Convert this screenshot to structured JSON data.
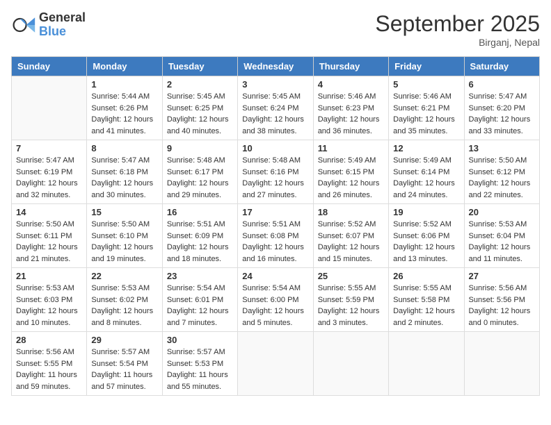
{
  "header": {
    "logo_general": "General",
    "logo_blue": "Blue",
    "month": "September 2025",
    "location": "Birganj, Nepal"
  },
  "days_of_week": [
    "Sunday",
    "Monday",
    "Tuesday",
    "Wednesday",
    "Thursday",
    "Friday",
    "Saturday"
  ],
  "weeks": [
    [
      {
        "day": "",
        "info": ""
      },
      {
        "day": "1",
        "info": "Sunrise: 5:44 AM\nSunset: 6:26 PM\nDaylight: 12 hours\nand 41 minutes."
      },
      {
        "day": "2",
        "info": "Sunrise: 5:45 AM\nSunset: 6:25 PM\nDaylight: 12 hours\nand 40 minutes."
      },
      {
        "day": "3",
        "info": "Sunrise: 5:45 AM\nSunset: 6:24 PM\nDaylight: 12 hours\nand 38 minutes."
      },
      {
        "day": "4",
        "info": "Sunrise: 5:46 AM\nSunset: 6:23 PM\nDaylight: 12 hours\nand 36 minutes."
      },
      {
        "day": "5",
        "info": "Sunrise: 5:46 AM\nSunset: 6:21 PM\nDaylight: 12 hours\nand 35 minutes."
      },
      {
        "day": "6",
        "info": "Sunrise: 5:47 AM\nSunset: 6:20 PM\nDaylight: 12 hours\nand 33 minutes."
      }
    ],
    [
      {
        "day": "7",
        "info": "Sunrise: 5:47 AM\nSunset: 6:19 PM\nDaylight: 12 hours\nand 32 minutes."
      },
      {
        "day": "8",
        "info": "Sunrise: 5:47 AM\nSunset: 6:18 PM\nDaylight: 12 hours\nand 30 minutes."
      },
      {
        "day": "9",
        "info": "Sunrise: 5:48 AM\nSunset: 6:17 PM\nDaylight: 12 hours\nand 29 minutes."
      },
      {
        "day": "10",
        "info": "Sunrise: 5:48 AM\nSunset: 6:16 PM\nDaylight: 12 hours\nand 27 minutes."
      },
      {
        "day": "11",
        "info": "Sunrise: 5:49 AM\nSunset: 6:15 PM\nDaylight: 12 hours\nand 26 minutes."
      },
      {
        "day": "12",
        "info": "Sunrise: 5:49 AM\nSunset: 6:14 PM\nDaylight: 12 hours\nand 24 minutes."
      },
      {
        "day": "13",
        "info": "Sunrise: 5:50 AM\nSunset: 6:12 PM\nDaylight: 12 hours\nand 22 minutes."
      }
    ],
    [
      {
        "day": "14",
        "info": "Sunrise: 5:50 AM\nSunset: 6:11 PM\nDaylight: 12 hours\nand 21 minutes."
      },
      {
        "day": "15",
        "info": "Sunrise: 5:50 AM\nSunset: 6:10 PM\nDaylight: 12 hours\nand 19 minutes."
      },
      {
        "day": "16",
        "info": "Sunrise: 5:51 AM\nSunset: 6:09 PM\nDaylight: 12 hours\nand 18 minutes."
      },
      {
        "day": "17",
        "info": "Sunrise: 5:51 AM\nSunset: 6:08 PM\nDaylight: 12 hours\nand 16 minutes."
      },
      {
        "day": "18",
        "info": "Sunrise: 5:52 AM\nSunset: 6:07 PM\nDaylight: 12 hours\nand 15 minutes."
      },
      {
        "day": "19",
        "info": "Sunrise: 5:52 AM\nSunset: 6:06 PM\nDaylight: 12 hours\nand 13 minutes."
      },
      {
        "day": "20",
        "info": "Sunrise: 5:53 AM\nSunset: 6:04 PM\nDaylight: 12 hours\nand 11 minutes."
      }
    ],
    [
      {
        "day": "21",
        "info": "Sunrise: 5:53 AM\nSunset: 6:03 PM\nDaylight: 12 hours\nand 10 minutes."
      },
      {
        "day": "22",
        "info": "Sunrise: 5:53 AM\nSunset: 6:02 PM\nDaylight: 12 hours\nand 8 minutes."
      },
      {
        "day": "23",
        "info": "Sunrise: 5:54 AM\nSunset: 6:01 PM\nDaylight: 12 hours\nand 7 minutes."
      },
      {
        "day": "24",
        "info": "Sunrise: 5:54 AM\nSunset: 6:00 PM\nDaylight: 12 hours\nand 5 minutes."
      },
      {
        "day": "25",
        "info": "Sunrise: 5:55 AM\nSunset: 5:59 PM\nDaylight: 12 hours\nand 3 minutes."
      },
      {
        "day": "26",
        "info": "Sunrise: 5:55 AM\nSunset: 5:58 PM\nDaylight: 12 hours\nand 2 minutes."
      },
      {
        "day": "27",
        "info": "Sunrise: 5:56 AM\nSunset: 5:56 PM\nDaylight: 12 hours\nand 0 minutes."
      }
    ],
    [
      {
        "day": "28",
        "info": "Sunrise: 5:56 AM\nSunset: 5:55 PM\nDaylight: 11 hours\nand 59 minutes."
      },
      {
        "day": "29",
        "info": "Sunrise: 5:57 AM\nSunset: 5:54 PM\nDaylight: 11 hours\nand 57 minutes."
      },
      {
        "day": "30",
        "info": "Sunrise: 5:57 AM\nSunset: 5:53 PM\nDaylight: 11 hours\nand 55 minutes."
      },
      {
        "day": "",
        "info": ""
      },
      {
        "day": "",
        "info": ""
      },
      {
        "day": "",
        "info": ""
      },
      {
        "day": "",
        "info": ""
      }
    ]
  ]
}
